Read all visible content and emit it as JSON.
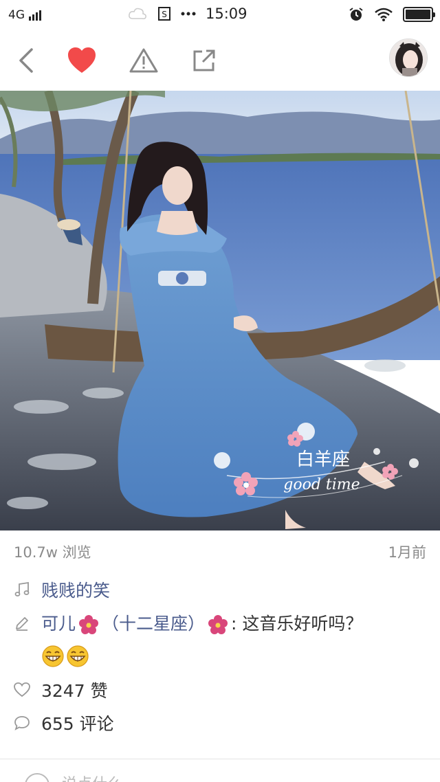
{
  "status_bar": {
    "network": "4G",
    "time": "15:09",
    "battery_level": 1.0
  },
  "toolbar": {
    "back_icon": "chevron-left-icon",
    "like_icon": "heart-icon",
    "report_icon": "warning-icon",
    "share_icon": "share-icon",
    "accent_color": "#f24a4a"
  },
  "photo": {
    "overlay_title": "白羊座",
    "overlay_subtitle": "good time"
  },
  "post": {
    "views": "10.7w 浏览",
    "time_ago": "1月前",
    "music_title": "贱贱的笑",
    "author_prefix": "可儿",
    "author_suffix": "（十二星座）",
    "comment_text": ": 这音乐好听吗？",
    "likes": "3247 赞",
    "comments": "655 评论",
    "link_color": "#4a5b8c"
  },
  "bottom": {
    "input_placeholder": "说点什么..."
  }
}
